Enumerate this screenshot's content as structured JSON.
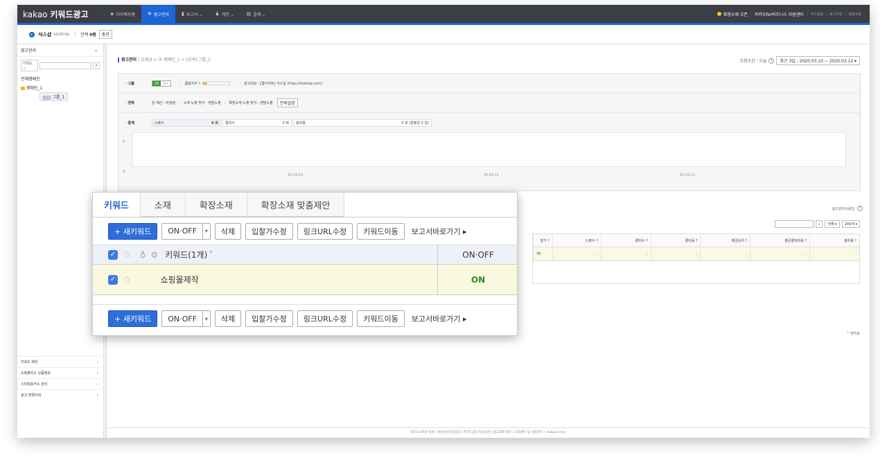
{
  "topbar": {
    "logo_prefix": "kakao",
    "logo_name": "키워드광고",
    "nav": [
      {
        "icon": "◈",
        "label": "다이렉트홈"
      },
      {
        "icon": "❈",
        "label": "광고관리"
      },
      {
        "icon": "▮",
        "label": "보고서 ⌄"
      },
      {
        "icon": "♟",
        "label": "계정 ⌄"
      },
      {
        "icon": "▤",
        "label": "결제 ⌄"
      }
    ],
    "promo": "확장소재 오픈",
    "center": "카카오for비즈니스 지원센터",
    "links": [
      "식스샵님",
      "로그아웃",
      "정보수정"
    ]
  },
  "account": {
    "name": "식스샵",
    "id": "sixshop",
    "balance_label": "잔액",
    "balance": "0원",
    "charge_button": "충전"
  },
  "sidebar": {
    "title": "광고관리",
    "search_select": "키워드 ⌄",
    "tree": [
      "전체캠페인",
      "캠페인_1",
      "그룹_1"
    ],
    "group_tag": "검색",
    "menu": [
      "키워드 제안",
      "쇼핑플러스 상품정보",
      "스타일포커스 관리",
      "광고 변경이력"
    ]
  },
  "main": {
    "crumb_root": "광고관리",
    "crumb_path": "김경남 > ⦿ 캠페인_1 > [검색] 그룹_1",
    "period_label": "조회조건 : 오늘",
    "period_value": "최근 3일 : 2020.03.10 ~ 2020.03.12 ▾",
    "group_label": "· 그룹",
    "toggle_on": "ON",
    "toggle_off": "OFF",
    "quality_label": "품질지수 ?",
    "target_text": "광고대상 : [웹사이트] 식스샵 (http://sixshop.com)",
    "strategy_label": "· 전략",
    "strategy_text": "일 예산 : 미설정",
    "strategy_text2": "소재 노출 방식 : 랜덤노출",
    "strategy_text3": "확장소재 노출 방식 : 랜덤노출",
    "strategy_button": "전략설정",
    "stats_label": "· 통계",
    "stats": [
      {
        "name": "노출수",
        "value": "0 회"
      },
      {
        "name": "클릭수",
        "value": "0 회"
      },
      {
        "name": "총비용",
        "value": "0 원 (일평균 0 원)"
      }
    ],
    "chart_y": [
      "0",
      "0"
    ],
    "chart_x": [
      "20.03.10",
      "20.03.11",
      "20.03.12"
    ],
    "help_link": "광고관리사용팁",
    "filter_select": "전체 ▾",
    "page_size": "200개 ▾",
    "table_headers": [
      "찰가 ?",
      "노출수 ?",
      "클릭수 ?",
      "클릭률 ?",
      "평균순위 ?",
      "평균클릭비용 ?",
      "총비용 ?"
    ],
    "table_row": [
      "70",
      "-",
      "-",
      "-",
      "-",
      "-",
      "-"
    ],
    "sort_link": "^ 맨위로",
    "footer": "비즈니스회원 약관 | 개인정보처리방침 | 키워드광고 이용약관 | 광고게재 약관 | 고객센터 및 이용문의   ⓒ Kakao Corp."
  },
  "popup": {
    "tabs": [
      "키워드",
      "소재",
      "확장소재",
      "확장소재 맞춤제안"
    ],
    "new_keyword": "+ 새키워드",
    "onoff": "ON·OFF",
    "delete": "삭제",
    "bid_edit": "입찰가수정",
    "link_edit": "링크URL수정",
    "move": "키워드이동",
    "report": "보고서바로가기 ▸",
    "header_keyword": "키워드(1개)",
    "header_onoff": "ON·OFF",
    "keyword": "쇼핑몰제작",
    "keyword_state": "ON"
  }
}
